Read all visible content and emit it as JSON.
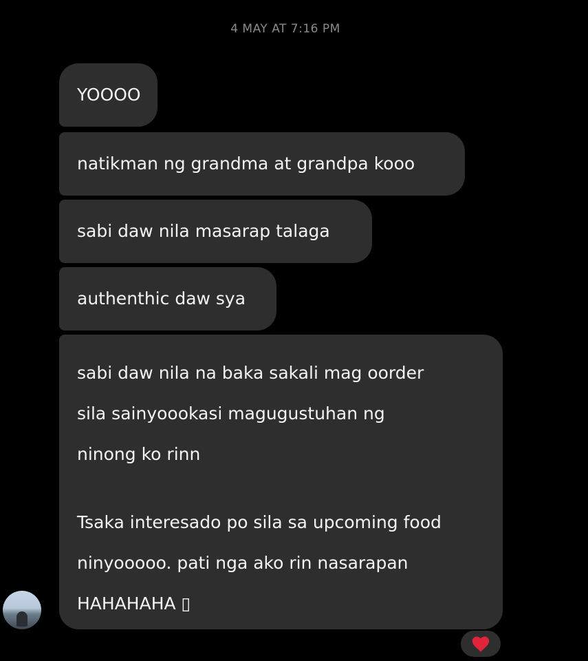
{
  "chat": {
    "timestamp": "4 MAY AT 7:16 PM",
    "messages": [
      {
        "text": "YOOOO"
      },
      {
        "text": "natikman ng grandma at grandpa kooo"
      },
      {
        "text": "sabi daw nila masarap talaga"
      },
      {
        "text": "authenthic daw sya"
      },
      {
        "lines": [
          "sabi daw nila na baka sakali mag oorder",
          "sila sainyoookasi magugustuhan ng",
          "ninong ko rinn",
          "Tsaka interesado po sila sa upcoming food",
          "ninyooooo. pati nga ako rin nasarapan",
          "HAHAHAHA ▯"
        ]
      }
    ],
    "reaction": {
      "icon": "heart-icon",
      "color": "#e0243a"
    },
    "sender_avatar": {
      "icon": "avatar-photo"
    }
  },
  "colors": {
    "background": "#000000",
    "bubble": "#2e2e2e",
    "timestamp": "#8a8a8a"
  }
}
